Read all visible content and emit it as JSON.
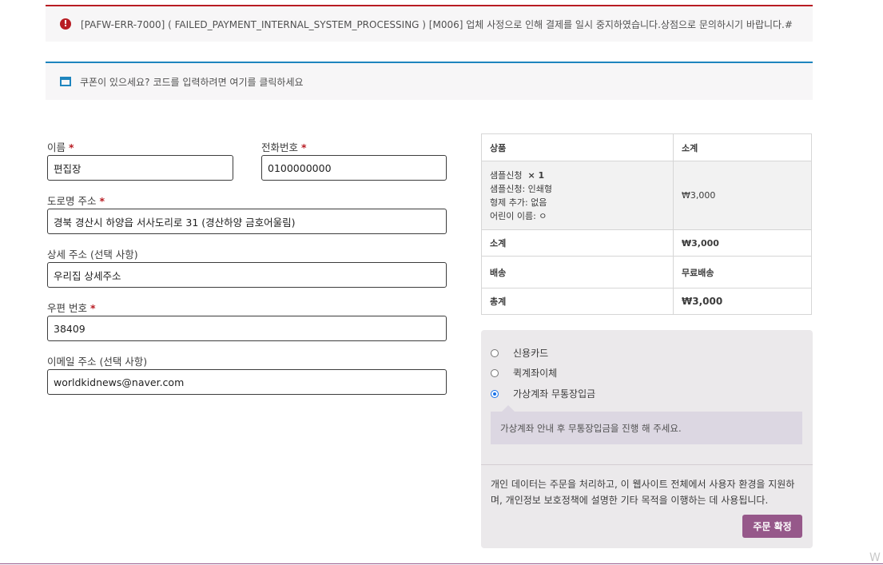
{
  "error_notice": {
    "icon": "error-circle-icon",
    "text": "[PAFW-ERR-7000] ( FAILED_PAYMENT_INTERNAL_SYSTEM_PROCESSING ) [M006] 업체 사정으로 인해 결제를 일시 중지하였습니다.상점으로 문의하시기 바랍니다.#"
  },
  "coupon_notice": {
    "icon": "window-icon",
    "question": "쿠폰이 있으세요?",
    "link": "코드를 입력하려면 여기를 클릭하세요"
  },
  "form": {
    "name": {
      "label": "이름",
      "required": "*",
      "value": "편집장"
    },
    "phone": {
      "label": "전화번호",
      "required": "*",
      "value": "0100000000"
    },
    "address": {
      "label": "도로명 주소",
      "required": "*",
      "value": "경북 경산시 하양읍 서사도리로 31 (경산하양 금호어울림)"
    },
    "address2": {
      "label": "상세 주소 (선택 사항)",
      "value": "우리집 상세주소"
    },
    "postcode": {
      "label": "우편 번호",
      "required": "*",
      "value": "38409"
    },
    "email": {
      "label": "이메일 주소 (선택 사항)",
      "value": "worldkidnews@naver.com"
    }
  },
  "order": {
    "header_product": "상품",
    "header_subtotal": "소계",
    "item": {
      "name": "샘플신청",
      "qty": "× 1",
      "meta": [
        "샘플신청: 인쇄형",
        "형제 추가: 없음",
        "어린이 이름: ㅇ"
      ],
      "price": "₩3,000"
    },
    "subtotal_label": "소계",
    "subtotal_value": "₩3,000",
    "shipping_label": "배송",
    "shipping_value": "무료배송",
    "total_label": "총계",
    "total_value": "₩3,000"
  },
  "payment": {
    "options": [
      {
        "label": "신용카드",
        "selected": false
      },
      {
        "label": "퀵계좌이체",
        "selected": false
      },
      {
        "label": "가상계좌 무통장입금",
        "selected": true
      }
    ],
    "description": "가상계좌 안내 후 무통장입금을 진행 해 주세요.",
    "privacy": "개인 데이터는 주문을 처리하고, 이 웹사이트 전체에서 사용자 환경을 지원하며, 개인정보 보호정책에 설명한 기타 목적을 이행하는 데 사용됩니다.",
    "place_order": "주문 확정"
  },
  "colors": {
    "error_accent": "#b81c23",
    "info_accent": "#1e85be",
    "button": "#96588a",
    "payment_bg": "#ebe9eb"
  },
  "corner_mark": "W"
}
